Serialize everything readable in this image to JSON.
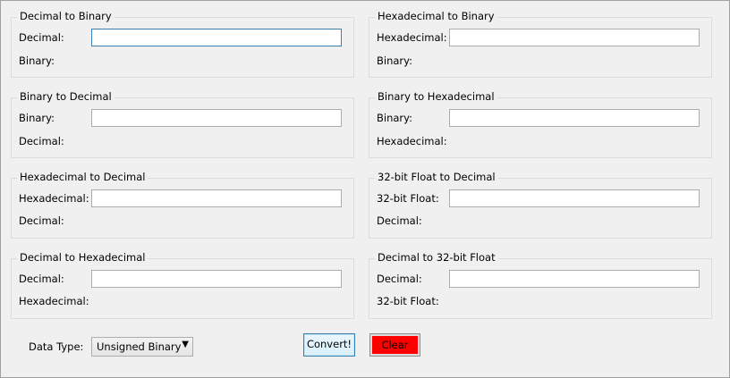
{
  "groups": [
    {
      "title": "Decimal to Binary",
      "input_label": "Decimal:",
      "output_label": "Binary:",
      "value": ""
    },
    {
      "title": "Hexadecimal to Binary",
      "input_label": "Hexadecimal:",
      "output_label": "Binary:",
      "value": ""
    },
    {
      "title": "Binary to Decimal",
      "input_label": "Binary:",
      "output_label": "Decimal:",
      "value": ""
    },
    {
      "title": "Binary to Hexadecimal",
      "input_label": "Binary:",
      "output_label": "Hexadecimal:",
      "value": ""
    },
    {
      "title": "Hexadecimal to Decimal",
      "input_label": "Hexadecimal:",
      "output_label": "Decimal:",
      "value": ""
    },
    {
      "title": "32-bit Float to Decimal",
      "input_label": "32-bit Float:",
      "output_label": "Decimal:",
      "value": ""
    },
    {
      "title": "Decimal to Hexadecimal",
      "input_label": "Decimal:",
      "output_label": "Hexadecimal:",
      "value": ""
    },
    {
      "title": "Decimal to 32-bit Float",
      "input_label": "Decimal:",
      "output_label": "32-bit Float:",
      "value": ""
    }
  ],
  "footer": {
    "data_type_label": "Data Type:",
    "data_type_selected": "Unsigned Binary",
    "dropdown_icon": "chevron-down-icon",
    "convert_label": "Convert!",
    "clear_label": "Clear",
    "clear_color": "#ff0000"
  }
}
